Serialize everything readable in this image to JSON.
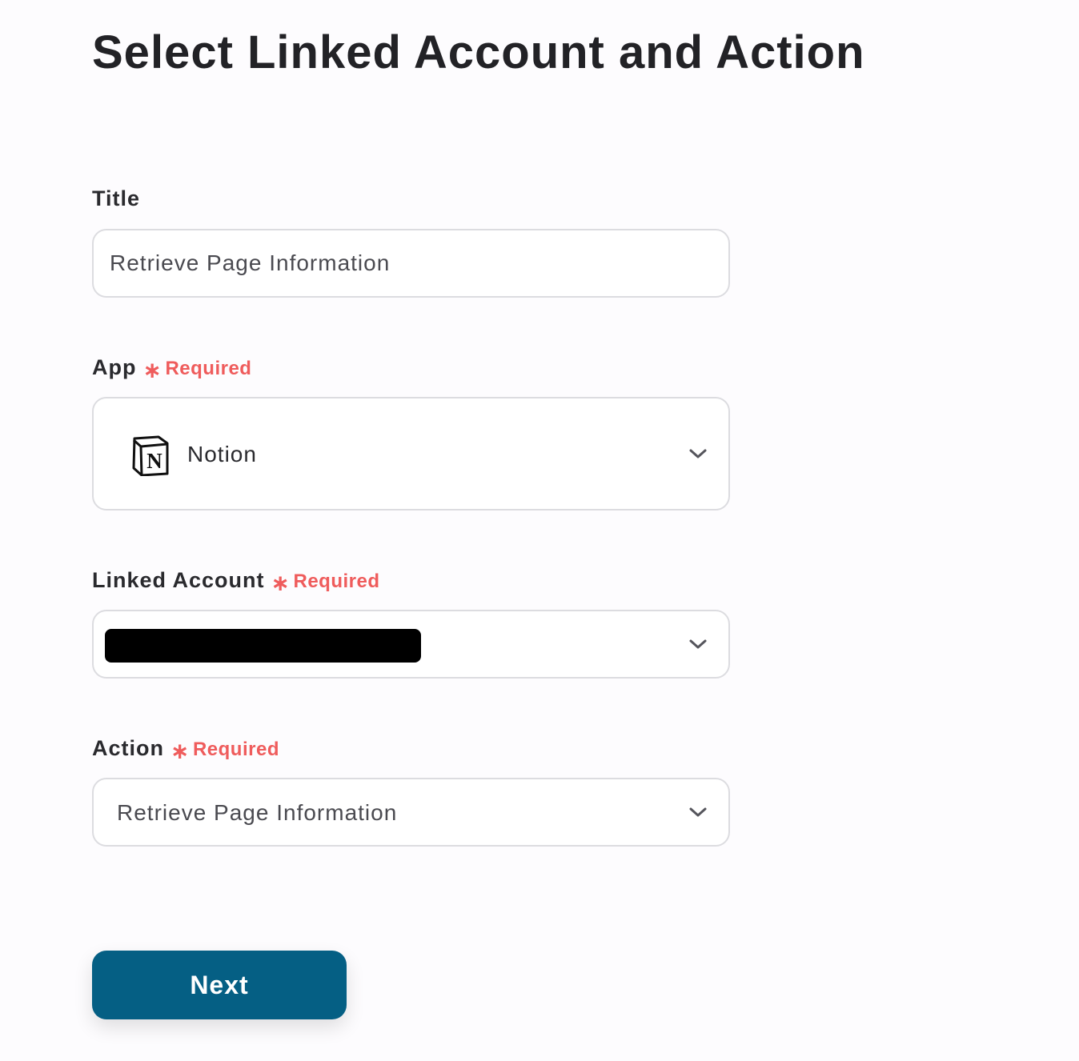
{
  "page": {
    "title": "Select Linked Account and Action"
  },
  "fields": {
    "title": {
      "label": "Title",
      "value": "Retrieve Page Information"
    },
    "app": {
      "label": "App",
      "required_label": "Required",
      "required_marker": "∗",
      "value": "Notion",
      "icon": "notion-logo-icon",
      "logo_letter": "N"
    },
    "linked_account": {
      "label": "Linked Account",
      "required_label": "Required",
      "required_marker": "∗",
      "value_redacted": true
    },
    "action": {
      "label": "Action",
      "required_label": "Required",
      "required_marker": "∗",
      "value": "Retrieve Page Information"
    }
  },
  "buttons": {
    "next_label": "Next"
  },
  "colors": {
    "required": "#ef5c5c",
    "primary_button": "#055f84",
    "border": "#dcdce0",
    "text": "#222226"
  }
}
